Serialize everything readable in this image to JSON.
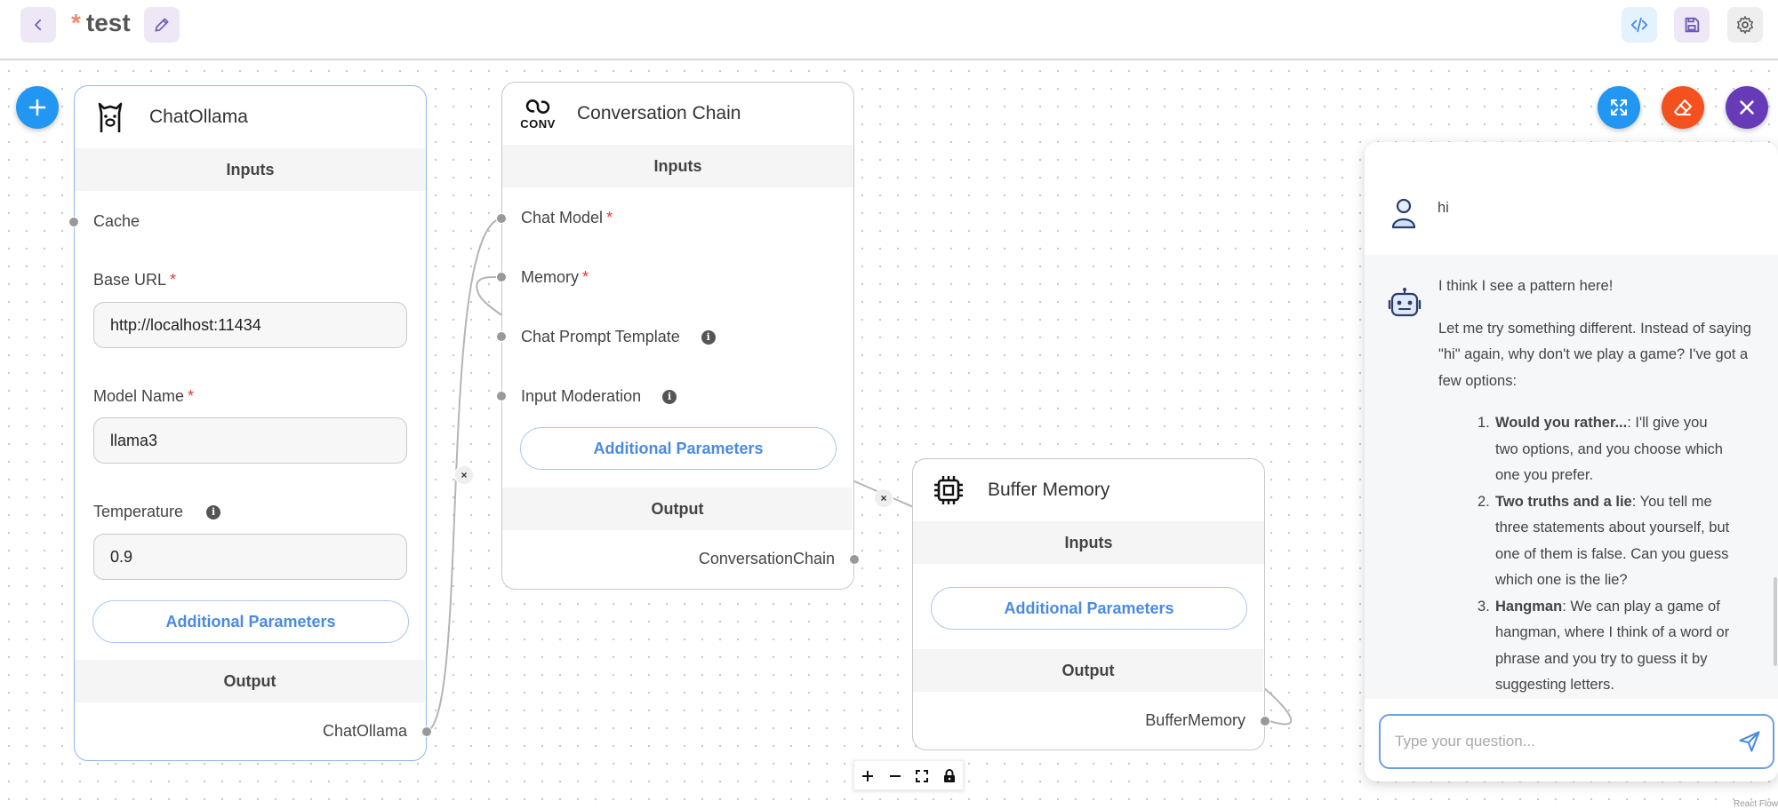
{
  "header": {
    "unsaved_marker": "*",
    "title": "test"
  },
  "nodes": {
    "chat_ollama": {
      "title": "ChatOllama",
      "inputs_label": "Inputs",
      "cache_label": "Cache",
      "base_url_label": "Base URL",
      "base_url_value": "http://localhost:11434",
      "model_name_label": "Model Name",
      "model_name_value": "llama3",
      "temperature_label": "Temperature",
      "temperature_value": "0.9",
      "additional_params": "Additional Parameters",
      "output_label": "Output",
      "output_name": "ChatOllama",
      "required_marker": "*"
    },
    "conversation_chain": {
      "title": "Conversation Chain",
      "icon_text": "CONV",
      "inputs_label": "Inputs",
      "chat_model_label": "Chat Model",
      "memory_label": "Memory",
      "prompt_label": "Chat Prompt Template",
      "moderation_label": "Input Moderation",
      "additional_params": "Additional Parameters",
      "output_label": "Output",
      "output_name": "ConversationChain",
      "required_marker": "*"
    },
    "buffer_memory": {
      "title": "Buffer Memory",
      "inputs_label": "Inputs",
      "additional_params": "Additional Parameters",
      "output_label": "Output",
      "output_name": "BufferMemory"
    }
  },
  "edge_delete_glyph": "×",
  "chat": {
    "user_message": "hi",
    "bot_intro": "I think I see a pattern here!",
    "bot_body": "Let me try something different. Instead of saying \"hi\" again, why don't we play a game? I've got a few options:",
    "options": [
      {
        "num": "1.",
        "title": "Would you rather...",
        "text": ": I'll give you two options, and you choose which one you prefer."
      },
      {
        "num": "2.",
        "title": "Two truths and a lie",
        "text": ": You tell me three statements about yourself, but one of them is false. Can you guess which one is the lie?"
      },
      {
        "num": "3.",
        "title": "Hangman",
        "text": ": We can play a game of hangman, where I think of a word or phrase and you try to guess it by suggesting letters."
      }
    ],
    "input_placeholder": "Type your question..."
  },
  "attribution": "React Flow",
  "colors": {
    "fab_add": "#2196f3",
    "fab_expand": "#2196f3",
    "fab_clear": "#f4511e",
    "fab_close": "#673ab7",
    "accent_blue": "#4a8ae0",
    "required_red": "#e53935"
  }
}
